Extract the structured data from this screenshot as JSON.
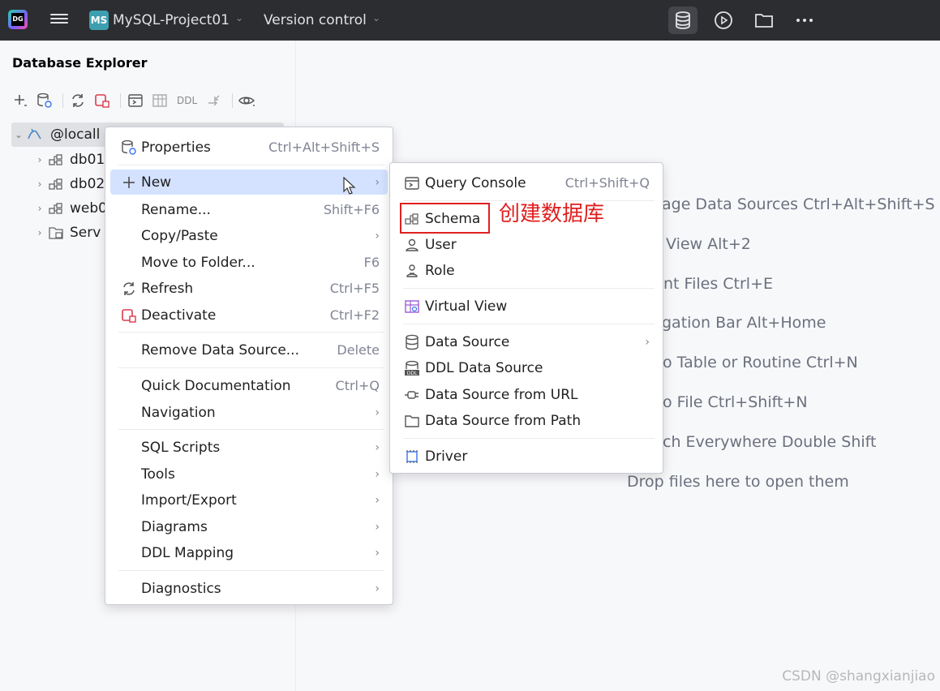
{
  "titlebar": {
    "app_logo": "DG",
    "project_badge": "MS",
    "project_name": "MySQL-Project01",
    "vcs_label": "Version control",
    "icons": [
      "database-icon",
      "run-icon",
      "folder-icon",
      "more-icon"
    ]
  },
  "panel": {
    "title": "Database Explorer",
    "toolbar": {
      "ddl_label": "DDL",
      "icons": [
        "add-icon",
        "datasource-properties-icon",
        "refresh-icon",
        "deactivate-icon",
        "query-console-icon",
        "table-icon",
        "ddl-icon",
        "jump-icon",
        "view-options-icon"
      ]
    },
    "tree": [
      {
        "label": "@locall",
        "icon": "mysql-icon",
        "expanded": true
      },
      {
        "label": "db01",
        "icon": "schema-icon"
      },
      {
        "label": "db02",
        "icon": "schema-icon"
      },
      {
        "label": "web0",
        "icon": "schema-icon"
      },
      {
        "label": "Serv",
        "icon": "server-objects-icon"
      }
    ]
  },
  "welcome_hints": [
    "age Data Sources Ctrl+Alt+Shift+S",
    "View Alt+2",
    "nt Files Ctrl+E",
    "gation Bar Alt+Home",
    "o Table or Routine Ctrl+N",
    "o File Ctrl+Shift+N",
    "ch Everywhere Double Shift",
    "Drop files here to open them"
  ],
  "context_menu": {
    "items": [
      {
        "label": "Properties",
        "shortcut": "Ctrl+Alt+Shift+S",
        "icon": "properties-icon"
      },
      {
        "label": "New",
        "icon": "plus-icon",
        "submenu": true,
        "highlighted": true
      },
      {
        "label": "Rename...",
        "shortcut": "Shift+F6"
      },
      {
        "label": "Copy/Paste",
        "submenu": true
      },
      {
        "label": "Move to Folder...",
        "shortcut": "F6"
      },
      {
        "label": "Refresh",
        "shortcut": "Ctrl+F5",
        "icon": "refresh-icon"
      },
      {
        "label": "Deactivate",
        "shortcut": "Ctrl+F2",
        "icon": "deactivate-icon"
      },
      {
        "label": "Remove Data Source...",
        "shortcut": "Delete"
      },
      {
        "label": "Quick Documentation",
        "shortcut": "Ctrl+Q"
      },
      {
        "label": "Navigation",
        "submenu": true
      },
      {
        "label": "SQL Scripts",
        "submenu": true
      },
      {
        "label": "Tools",
        "submenu": true
      },
      {
        "label": "Import/Export",
        "submenu": true
      },
      {
        "label": "Diagrams",
        "submenu": true
      },
      {
        "label": "DDL Mapping",
        "submenu": true
      },
      {
        "label": "Diagnostics",
        "submenu": true
      }
    ]
  },
  "submenu": {
    "items": [
      {
        "label": "Query Console",
        "shortcut": "Ctrl+Shift+Q",
        "icon": "query-console-icon"
      },
      {
        "label": "Schema",
        "icon": "schema-icon"
      },
      {
        "label": "User",
        "icon": "user-icon"
      },
      {
        "label": "Role",
        "icon": "role-icon"
      },
      {
        "label": "Virtual View",
        "icon": "virtual-view-icon"
      },
      {
        "label": "Data Source",
        "icon": "datasource-icon",
        "submenu": true
      },
      {
        "label": "DDL Data Source",
        "icon": "ddl-datasource-icon"
      },
      {
        "label": "Data Source from URL",
        "icon": "url-icon"
      },
      {
        "label": "Data Source from Path",
        "icon": "folder-icon"
      },
      {
        "label": "Driver",
        "icon": "driver-icon"
      }
    ]
  },
  "annotation": "创建数据库",
  "watermark": "CSDN @shangxianjiao",
  "colors": {
    "titlebar_bg": "#2b2d30",
    "menu_highlight": "#d4e2ff",
    "annotation_red": "#e02020",
    "project_badge": "#3d9fb0"
  }
}
